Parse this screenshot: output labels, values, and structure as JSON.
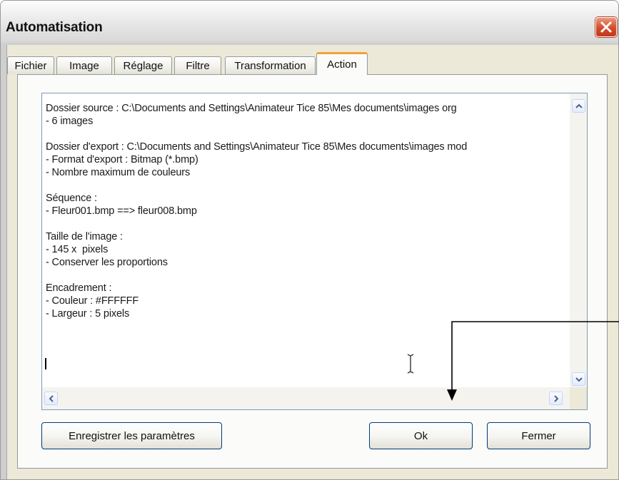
{
  "window": {
    "title": "Automatisation"
  },
  "tabs": [
    {
      "label": "Fichier"
    },
    {
      "label": "Image"
    },
    {
      "label": "Réglage"
    },
    {
      "label": "Filtre"
    },
    {
      "label": "Transformation"
    },
    {
      "label": "Action"
    }
  ],
  "active_tab": "Action",
  "summary": {
    "text": "Dossier source : C:\\Documents and Settings\\Animateur Tice 85\\Mes documents\\images org\n- 6 images\n\nDossier d'export : C:\\Documents and Settings\\Animateur Tice 85\\Mes documents\\images mod\n- Format d'export : Bitmap (*.bmp)\n- Nombre maximum de couleurs\n\nSéquence :\n- Fleur001.bmp ==> fleur008.bmp\n\nTaille de l'image :\n- 145 x  pixels\n- Conserver les proportions\n\nEncadrement :\n- Couleur : #FFFFFF\n- Largeur : 5 pixels"
  },
  "buttons": {
    "save_label": "Enregistrer les paramètres",
    "ok_label": "Ok",
    "close_label": "Fermer"
  },
  "colors": {
    "active_tab_accent": "#f3a23a",
    "close_button": "#d24b2b",
    "dialog_background": "#ece9d8"
  },
  "icons": {
    "close": "close-icon",
    "scroll_up": "chevron-up-icon",
    "scroll_down": "chevron-down-icon",
    "scroll_left": "chevron-left-icon",
    "scroll_right": "chevron-right-icon",
    "text_cursor": "ibeam-cursor-icon",
    "annotation": "arrow-annotation"
  }
}
